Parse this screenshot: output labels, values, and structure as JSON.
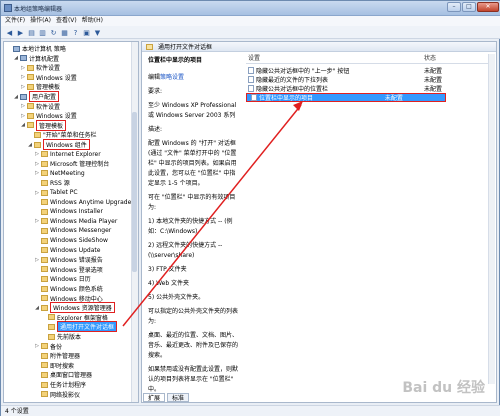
{
  "window": {
    "title": "本地组策略编辑器",
    "minimize": "–",
    "maximize": "□",
    "close": "✕"
  },
  "menu": [
    "文件(F)",
    "操作(A)",
    "查看(V)",
    "帮助(H)"
  ],
  "toolbar_icons": [
    "back-icon",
    "forward-icon",
    "up-icon",
    "show-hide-icon",
    "refresh-icon",
    "export-icon",
    "help-icon",
    "properties-icon",
    "filter-icon"
  ],
  "tree": [
    {
      "label": "本地计算机 策略",
      "indent": 0,
      "exp": "",
      "icon": "pc"
    },
    {
      "label": "计算机配置",
      "indent": 1,
      "exp": "◢",
      "icon": "pc"
    },
    {
      "label": "软件设置",
      "indent": 2,
      "exp": "▷",
      "icon": "folder"
    },
    {
      "label": "Windows 设置",
      "indent": 2,
      "exp": "▷",
      "icon": "folder"
    },
    {
      "label": "管理模板",
      "indent": 2,
      "exp": "▷",
      "icon": "folder"
    },
    {
      "label": "用户配置",
      "indent": 1,
      "exp": "◢",
      "icon": "pc"
    },
    {
      "label": "软件设置",
      "indent": 2,
      "exp": "▷",
      "icon": "folder"
    },
    {
      "label": "Windows 设置",
      "indent": 2,
      "exp": "▷",
      "icon": "folder"
    },
    {
      "label": "管理模板",
      "indent": 2,
      "exp": "◢",
      "icon": "folder"
    },
    {
      "label": "\"开始\"菜单和任务栏",
      "indent": 3,
      "exp": "",
      "icon": "folder"
    },
    {
      "label": "Windows 组件",
      "indent": 3,
      "exp": "◢",
      "icon": "folder"
    },
    {
      "label": "Internet Explorer",
      "indent": 4,
      "exp": "▷",
      "icon": "folder"
    },
    {
      "label": "Microsoft 管理控制台",
      "indent": 4,
      "exp": "▷",
      "icon": "folder"
    },
    {
      "label": "NetMeeting",
      "indent": 4,
      "exp": "▷",
      "icon": "folder"
    },
    {
      "label": "RSS 源",
      "indent": 4,
      "exp": "",
      "icon": "folder"
    },
    {
      "label": "Tablet PC",
      "indent": 4,
      "exp": "▷",
      "icon": "folder"
    },
    {
      "label": "Windows Anytime Upgrade",
      "indent": 4,
      "exp": "",
      "icon": "folder"
    },
    {
      "label": "Windows Installer",
      "indent": 4,
      "exp": "",
      "icon": "folder"
    },
    {
      "label": "Windows Media Player",
      "indent": 4,
      "exp": "▷",
      "icon": "folder"
    },
    {
      "label": "Windows Messenger",
      "indent": 4,
      "exp": "",
      "icon": "folder"
    },
    {
      "label": "Windows SideShow",
      "indent": 4,
      "exp": "",
      "icon": "folder"
    },
    {
      "label": "Windows Update",
      "indent": 4,
      "exp": "",
      "icon": "folder"
    },
    {
      "label": "Windows 错误报告",
      "indent": 4,
      "exp": "▷",
      "icon": "folder"
    },
    {
      "label": "Windows 登录选项",
      "indent": 4,
      "exp": "",
      "icon": "folder"
    },
    {
      "label": "Windows 日历",
      "indent": 4,
      "exp": "",
      "icon": "folder"
    },
    {
      "label": "Windows 颜色系统",
      "indent": 4,
      "exp": "",
      "icon": "folder"
    },
    {
      "label": "Windows 移动中心",
      "indent": 4,
      "exp": "",
      "icon": "folder"
    },
    {
      "label": "Windows 资源管理器",
      "indent": 4,
      "exp": "◢",
      "icon": "folder"
    },
    {
      "label": "Explorer 框架窗格",
      "indent": 5,
      "exp": "",
      "icon": "folder"
    },
    {
      "label": "通用打开文件对话框",
      "indent": 5,
      "exp": "",
      "icon": "folder"
    },
    {
      "label": "先前版本",
      "indent": 5,
      "exp": "",
      "icon": "folder"
    },
    {
      "label": "备份",
      "indent": 4,
      "exp": "▷",
      "icon": "folder"
    },
    {
      "label": "附件管理器",
      "indent": 4,
      "exp": "",
      "icon": "folder"
    },
    {
      "label": "即时搜索",
      "indent": 4,
      "exp": "",
      "icon": "folder"
    },
    {
      "label": "桌面窗口管理器",
      "indent": 4,
      "exp": "",
      "icon": "folder"
    },
    {
      "label": "任务计划程序",
      "indent": 4,
      "exp": "",
      "icon": "folder"
    },
    {
      "label": "网络投影仪",
      "indent": 4,
      "exp": "",
      "icon": "folder"
    }
  ],
  "right": {
    "header": "通用打开文件对话框",
    "desc_title": "位置栏中显示的项目",
    "desc_edit_prefix": "编辑",
    "desc_edit_link": "策略设置",
    "desc": [
      "要求:",
      "至少 Windows XP Professional 或 Windows Server 2003 系列",
      "描述:",
      "配置 Windows 的 \"打开\" 对话框(通过 \"文件\" 菜单打开中的 \"位置栏\" 中显示的项目列表。如果启用此设置，您可以在 \"位置栏\" 中指定显示 1-5 个项目。",
      "可在 \"位置栏\" 中显示的有效项目为:",
      "1) 本地文件夹的快捷方式 -- (例如：C:\\Windows)",
      "2) 远程文件夹的快捷方式 -- (\\\\server\\share)",
      "3) FTP 文件夹",
      "4) Web 文件夹",
      "5) 公共外壳文件夹。",
      "可以指定的公共外壳文件夹的列表为:",
      "桌面、最近的位置、文档、图片、音乐、最近更改、附件及已保存的搜索。",
      "如果禁用或没有配置此设置，则默认的项目列表将显示在 \"位置栏\" 中。"
    ],
    "col_setting": "设置",
    "col_state": "状态",
    "rows": [
      {
        "setting": "隐藏公共对话框中的 \"上一步\" 按钮",
        "state": "未配置"
      },
      {
        "setting": "隐藏最近的文件的下拉列表",
        "state": "未配置"
      },
      {
        "setting": "隐藏公共对话框中的位置栏",
        "state": "未配置"
      },
      {
        "setting": "位置栏中显示的项目",
        "state": "未配置"
      }
    ]
  },
  "tabs": [
    "扩展",
    "标准"
  ],
  "status": "4 个设置",
  "watermark": "Bai du 经验",
  "colors": {
    "highlight": "#e02020",
    "selection": "#3399ff",
    "link": "#1a55c6"
  }
}
